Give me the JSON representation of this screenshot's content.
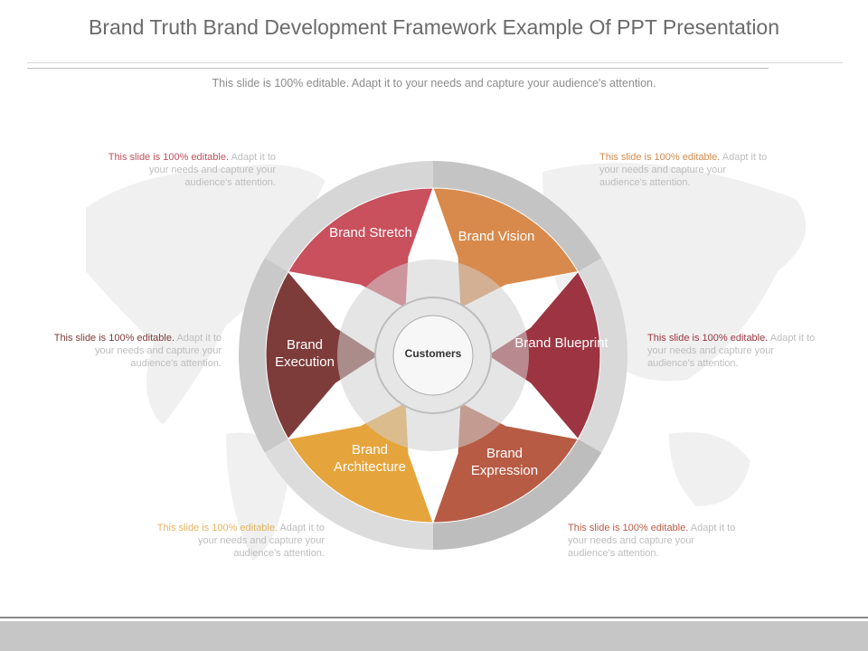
{
  "title": "Brand Truth Brand Development Framework Example Of PPT Presentation",
  "subtitle": "This slide is 100% editable. Adapt it to your needs and capture your audience's attention.",
  "center": "Customers",
  "segments": [
    {
      "label": "Brand Stretch",
      "color": "#c9505d"
    },
    {
      "label": "Brand Vision",
      "color": "#d88a4c"
    },
    {
      "label": "Brand Blueprint",
      "color": "#9c3541"
    },
    {
      "label": "Brand Expression",
      "color": "#b75b45"
    },
    {
      "label": "Brand Architecture",
      "color": "#e6a43c"
    },
    {
      "label": "Brand Execution",
      "color": "#7d3b39"
    }
  ],
  "notes": [
    {
      "lead": "This slide is 100% editable.",
      "rest": " Adapt it to your needs and capture your audience's attention.",
      "color": "#c0505c"
    },
    {
      "lead": "This slide is 100% editable.",
      "rest": " Adapt it to your needs and capture your audience's attention.",
      "color": "#d4894c"
    },
    {
      "lead": "This slide is 100% editable.",
      "rest": " Adapt it to your needs and capture your audience's attention.",
      "color": "#7d3b39"
    },
    {
      "lead": "This slide is 100% editable.",
      "rest": " Adapt it to your needs and capture your audience's attention.",
      "color": "#9c3541"
    },
    {
      "lead": "This slide is 100% editable.",
      "rest": " Adapt it to your needs and capture your audience's attention.",
      "color": "#e6b45c"
    },
    {
      "lead": "This slide is 100% editable.",
      "rest": " Adapt it to your needs and capture your audience's attention.",
      "color": "#b75b45"
    }
  ]
}
